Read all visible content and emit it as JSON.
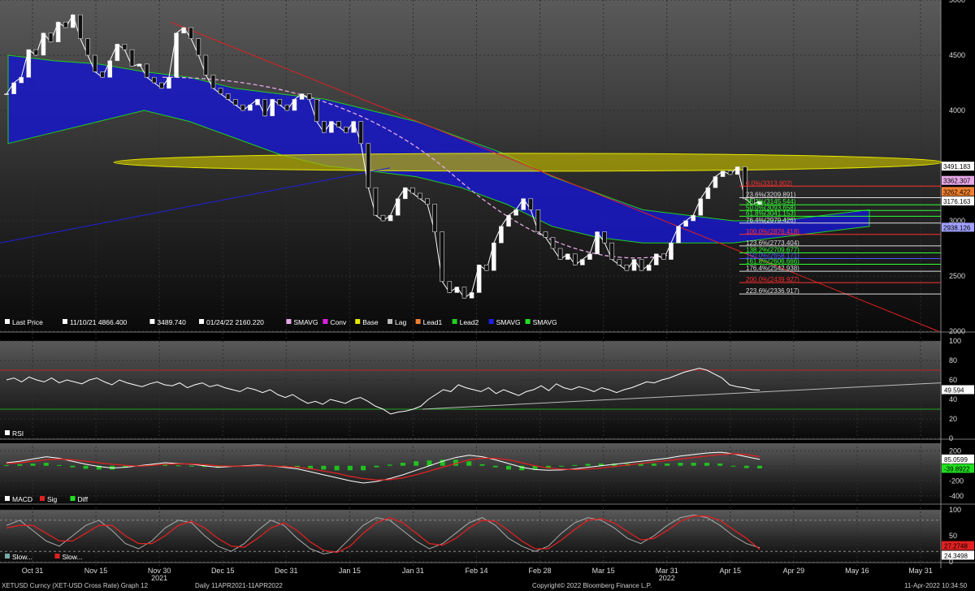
{
  "chart_data": {
    "type": "line",
    "security": "XETUSD Curncy (XET-USD Cross Rate) Graph 12",
    "footer_range": "Daily 11APR2021-11APR2022",
    "footer_copyright": "Copyright© 2022 Bloomberg Finance L.P.",
    "footer_time": "11-Apr-2022 10:34:50",
    "x_ticks": [
      "Oct 31",
      "Nov 15",
      "Nov 30",
      "Dec 15",
      "Dec 31",
      "Jan 15",
      "Jan 31",
      "Feb 14",
      "Feb 28",
      "Mar 15",
      "Mar 31",
      "Apr 15",
      "Apr 29",
      "May 16",
      "May 31"
    ],
    "year_labels": [
      "2021",
      "2022"
    ],
    "price_panel": {
      "y_ticks": [
        5000,
        4500,
        4000,
        3500,
        3000,
        2500,
        2000
      ],
      "ylim": [
        2000,
        5000
      ],
      "legend": [
        {
          "text": "Last Price",
          "color": "#ffffff"
        },
        {
          "text": "11/10/21 4866.400",
          "color": "#ffffff"
        },
        {
          "text": "3489.740",
          "color": "#ffffff"
        },
        {
          "text": "01/24/22 2160.220",
          "color": "#ffffff"
        },
        {
          "text": "SMAVG",
          "color": "#e6a8e6"
        },
        {
          "text": "Conv",
          "color": "#e020e0"
        },
        {
          "text": "Base",
          "color": "#e8e800"
        },
        {
          "text": "Lag",
          "color": "#bbbbbb"
        },
        {
          "text": "Lead1",
          "color": "#f08030"
        },
        {
          "text": "Lead2",
          "color": "#20d020"
        },
        {
          "text": "SMAVG",
          "color": "#2020e0"
        },
        {
          "text": "SMAVG",
          "color": "#20e020"
        }
      ],
      "right_tags": [
        {
          "text": "3491.183",
          "value": 3491.183,
          "bg": "#ffffff",
          "fg": "#000000"
        },
        {
          "text": "3362.307",
          "value": 3362.307,
          "bg": "#e6a8e6",
          "fg": "#000000"
        },
        {
          "text": "3262.422",
          "value": 3262.422,
          "bg": "#f08030",
          "fg": "#000000"
        },
        {
          "text": "3176.163",
          "value": 3176.163,
          "bg": "#ffffff",
          "fg": "#000000"
        },
        {
          "text": "2938.126",
          "value": 2938.126,
          "bg": "#a0a0ff",
          "fg": "#000000"
        }
      ],
      "fib_levels": [
        {
          "text": "0.0%(3313.902)",
          "value": 3313.902,
          "color": "#ff3030"
        },
        {
          "text": "23.6%(3209.891)",
          "value": 3209.891,
          "color": "#dddddd"
        },
        {
          "text": "38.2%(3145.544)",
          "value": 3145.544,
          "color": "#30ff30"
        },
        {
          "text": "50.0%(3093.658)",
          "value": 3093.658,
          "color": "#30ff30"
        },
        {
          "text": "61.8%(3041.153)",
          "value": 3041.153,
          "color": "#30ff30"
        },
        {
          "text": "76.4%(2979.426)",
          "value": 2979.426,
          "color": "#dddddd"
        },
        {
          "text": "100.0%(2876.418)",
          "value": 2876.418,
          "color": "#ff3030"
        },
        {
          "text": "123.6%(2773.404)",
          "value": 2773.404,
          "color": "#dddddd"
        },
        {
          "text": "138.2%(2709.677)",
          "value": 2709.677,
          "color": "#30ff30"
        },
        {
          "text": "150.0%(2658.171)",
          "value": 2658.171,
          "color": "#5050ff"
        },
        {
          "text": "161.8%(2606.666)",
          "value": 2606.666,
          "color": "#30ff30"
        },
        {
          "text": "176.4%(2542.938)",
          "value": 2542.938,
          "color": "#dddddd"
        },
        {
          "text": "200.0%(2439.927)",
          "value": 2439.927,
          "color": "#ff3030"
        },
        {
          "text": "223.6%(2336.917)",
          "value": 2336.917,
          "color": "#dddddd"
        }
      ],
      "close": [
        4150,
        4250,
        4300,
        4550,
        4500,
        4700,
        4620,
        4800,
        4750,
        4866,
        4650,
        4500,
        4350,
        4300,
        4450,
        4600,
        4550,
        4400,
        4420,
        4300,
        4250,
        4200,
        4300,
        4700,
        4750,
        4650,
        4500,
        4320,
        4200,
        4150,
        4100,
        4050,
        4000,
        4050,
        4100,
        3950,
        4100,
        4050,
        4000,
        4100,
        4150,
        4100,
        3900,
        3800,
        3900,
        3850,
        3800,
        3900,
        3700,
        3300,
        3050,
        3000,
        3050,
        3200,
        3300,
        3250,
        3200,
        3150,
        2900,
        2450,
        2350,
        2400,
        2300,
        2350,
        2600,
        2550,
        2800,
        2950,
        3050,
        3100,
        3200,
        3100,
        2900,
        2850,
        2750,
        2650,
        2700,
        2600,
        2650,
        2700,
        2900,
        2800,
        2650,
        2600,
        2550,
        2650,
        2550,
        2600,
        2700,
        2650,
        2800,
        2950,
        3000,
        3050,
        3200,
        3300,
        3400,
        3450,
        3420,
        3489,
        3200,
        3150,
        3176
      ]
    },
    "rsi_panel": {
      "label": "RSI",
      "y_ticks": [
        100,
        80,
        60,
        40,
        20,
        0
      ],
      "ylim": [
        0,
        100
      ],
      "last": "49.594",
      "upper": 70,
      "lower": 30,
      "values": [
        60,
        62,
        58,
        63,
        60,
        58,
        62,
        57,
        60,
        58,
        56,
        60,
        62,
        58,
        55,
        60,
        57,
        55,
        53,
        56,
        58,
        55,
        54,
        57,
        52,
        55,
        57,
        53,
        55,
        52,
        50,
        48,
        52,
        50,
        47,
        50,
        45,
        42,
        45,
        40,
        36,
        38,
        35,
        40,
        38,
        36,
        40,
        42,
        38,
        33,
        30,
        25,
        27,
        28,
        30,
        33,
        40,
        45,
        50,
        48,
        55,
        52,
        50,
        48,
        52,
        46,
        50,
        47,
        44,
        48,
        50,
        54,
        49,
        56,
        52,
        50,
        53,
        51,
        48,
        52,
        50,
        47,
        50,
        52,
        55,
        58,
        57,
        60,
        62,
        65,
        68,
        70,
        72,
        70,
        66,
        62,
        55,
        53,
        52,
        50,
        49.594
      ]
    },
    "macd_panel": {
      "labels": [
        "MACD",
        "Sig",
        "Diff"
      ],
      "y_ticks": [
        200,
        0,
        -200,
        -400
      ],
      "ylim": [
        -500,
        300
      ],
      "last_macd": "85.0599",
      "last_sig": "-39.8922",
      "macd": [
        40,
        60,
        90,
        120,
        100,
        60,
        20,
        -10,
        -30,
        -20,
        0,
        20,
        40,
        30,
        20,
        0,
        -20,
        -10,
        0,
        10,
        0,
        -20,
        -40,
        -80,
        -120,
        -160,
        -200,
        -230,
        -210,
        -170,
        -120,
        -60,
        0,
        60,
        110,
        140,
        120,
        80,
        30,
        -20,
        -50,
        -60,
        -55,
        -40,
        -20,
        0,
        20,
        40,
        60,
        80,
        100,
        130,
        150,
        170,
        180,
        160,
        120,
        85
      ],
      "sig": [
        30,
        40,
        60,
        80,
        90,
        80,
        60,
        40,
        20,
        5,
        -5,
        5,
        20,
        25,
        25,
        15,
        0,
        -5,
        -5,
        0,
        0,
        -10,
        -20,
        -40,
        -70,
        -100,
        -140,
        -170,
        -190,
        -185,
        -160,
        -120,
        -70,
        -20,
        30,
        80,
        100,
        100,
        80,
        40,
        0,
        -30,
        -45,
        -50,
        -45,
        -30,
        -10,
        10,
        30,
        50,
        70,
        90,
        110,
        130,
        150,
        160,
        150,
        120
      ]
    },
    "stoch_panel": {
      "labels": [
        "Slow...",
        "Slow..."
      ],
      "y_ticks": [
        100,
        50,
        0
      ],
      "ylim": [
        0,
        100
      ],
      "last_k": "27.2748",
      "last_d": "24.3498",
      "upper": 80,
      "lower": 20,
      "k": [
        70,
        80,
        60,
        40,
        30,
        50,
        70,
        80,
        60,
        35,
        25,
        40,
        65,
        80,
        75,
        50,
        30,
        20,
        35,
        60,
        80,
        70,
        45,
        25,
        15,
        20,
        45,
        70,
        85,
        80,
        60,
        40,
        25,
        35,
        55,
        75,
        85,
        70,
        45,
        30,
        20,
        30,
        55,
        75,
        85,
        80,
        65,
        45,
        35,
        50,
        70,
        85,
        90,
        85,
        70,
        50,
        35,
        27
      ],
      "d": [
        65,
        70,
        70,
        55,
        40,
        40,
        55,
        70,
        70,
        50,
        35,
        35,
        50,
        70,
        78,
        65,
        45,
        30,
        28,
        45,
        65,
        75,
        60,
        38,
        22,
        18,
        30,
        55,
        75,
        85,
        75,
        55,
        35,
        32,
        45,
        65,
        80,
        78,
        60,
        40,
        25,
        25,
        42,
        62,
        80,
        83,
        75,
        58,
        42,
        45,
        60,
        78,
        88,
        88,
        80,
        62,
        45,
        24
      ]
    }
  }
}
